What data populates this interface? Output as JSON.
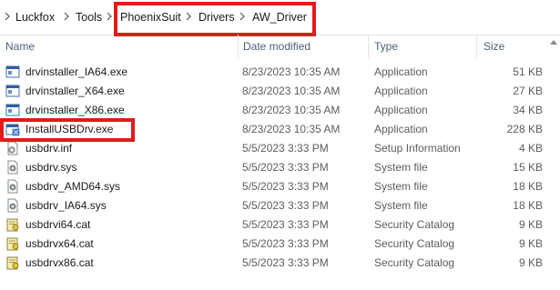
{
  "breadcrumb": {
    "items": [
      "Luckfox",
      "Tools",
      "PhoenixSuit",
      "Drivers",
      "AW_Driver"
    ]
  },
  "columns": {
    "name": "Name",
    "date": "Date modified",
    "type": "Type",
    "size": "Size"
  },
  "files": [
    {
      "name": "drvinstaller_IA64.exe",
      "date": "8/23/2023 10:35 AM",
      "type": "Application",
      "size": "51 KB",
      "icon": "application-icon"
    },
    {
      "name": "drvinstaller_X64.exe",
      "date": "8/23/2023 10:35 AM",
      "type": "Application",
      "size": "27 KB",
      "icon": "application-icon"
    },
    {
      "name": "drvinstaller_X86.exe",
      "date": "8/23/2023 10:35 AM",
      "type": "Application",
      "size": "34 KB",
      "icon": "application-icon"
    },
    {
      "name": "InstallUSBDrv.exe",
      "date": "8/23/2023 10:35 AM",
      "type": "Application",
      "size": "228 KB",
      "icon": "installer-icon"
    },
    {
      "name": "usbdrv.inf",
      "date": "5/5/2023 3:33 PM",
      "type": "Setup Information",
      "size": "4 KB",
      "icon": "setup-info-icon"
    },
    {
      "name": "usbdrv.sys",
      "date": "5/5/2023 3:33 PM",
      "type": "System file",
      "size": "15 KB",
      "icon": "system-file-icon"
    },
    {
      "name": "usbdrv_AMD64.sys",
      "date": "5/5/2023 3:33 PM",
      "type": "System file",
      "size": "18 KB",
      "icon": "system-file-icon"
    },
    {
      "name": "usbdrv_IA64.sys",
      "date": "5/5/2023 3:33 PM",
      "type": "System file",
      "size": "18 KB",
      "icon": "system-file-icon"
    },
    {
      "name": "usbdrvi64.cat",
      "date": "5/5/2023 3:33 PM",
      "type": "Security Catalog",
      "size": "9 KB",
      "icon": "security-catalog-icon"
    },
    {
      "name": "usbdrvx64.cat",
      "date": "5/5/2023 3:33 PM",
      "type": "Security Catalog",
      "size": "9 KB",
      "icon": "security-catalog-icon"
    },
    {
      "name": "usbdrvx86.cat",
      "date": "5/5/2023 3:33 PM",
      "type": "Security Catalog",
      "size": "9 KB",
      "icon": "security-catalog-icon"
    }
  ],
  "colors": {
    "highlight": "#e21b1b",
    "header_text": "#4c607a",
    "secondary_text": "#5c5c5c"
  }
}
